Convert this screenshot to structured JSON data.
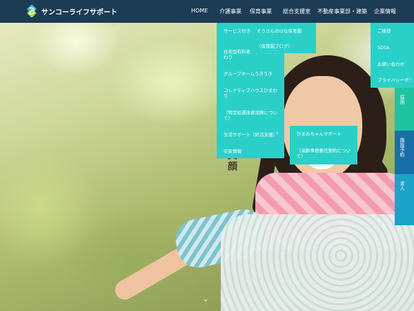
{
  "header": {
    "brand": "サンコーライフサポート",
    "nav": [
      "HOME",
      "介護事業",
      "保育事業",
      "総合支援室",
      "不動産事業部・建築",
      "企業情報"
    ]
  },
  "hero": {
    "vertical_text": "す　笑顔"
  },
  "kaigo_menu": {
    "items": [
      "サービス付き住宅 スリー",
      "住宅型有料老人ホームひまわり",
      "グループホームうきうき",
      "コレクティブハウスひまわり",
      "（特定処遇改善加算について）",
      "生活サポート（終活支援）",
      "空家情報"
    ]
  },
  "hoiku_menu": {
    "items": [
      "そうさんのはな保育園",
      "（保育園ブログ）"
    ]
  },
  "seikatsu_submenu": {
    "items": [
      "ひまみちゃんサポート",
      "（高齢事務委託契約について）"
    ]
  },
  "kigyo_menu": {
    "items": [
      "ご挨拶",
      "SDGs",
      "お問い合わせ",
      "プライバシーポリ"
    ]
  },
  "side_buttons": [
    {
      "label": "採用",
      "color": "#20c3a0"
    },
    {
      "label": "施設予約",
      "color": "#1a6ea8"
    },
    {
      "label": "求人",
      "color": "#1aa5c8"
    }
  ],
  "colors": {
    "header_bg": "#1c3b55",
    "dropdown_bg": "#2ad0c8"
  },
  "icons": {
    "scroll": "chevron-down-icon",
    "logo": "logo-mark-icon"
  }
}
